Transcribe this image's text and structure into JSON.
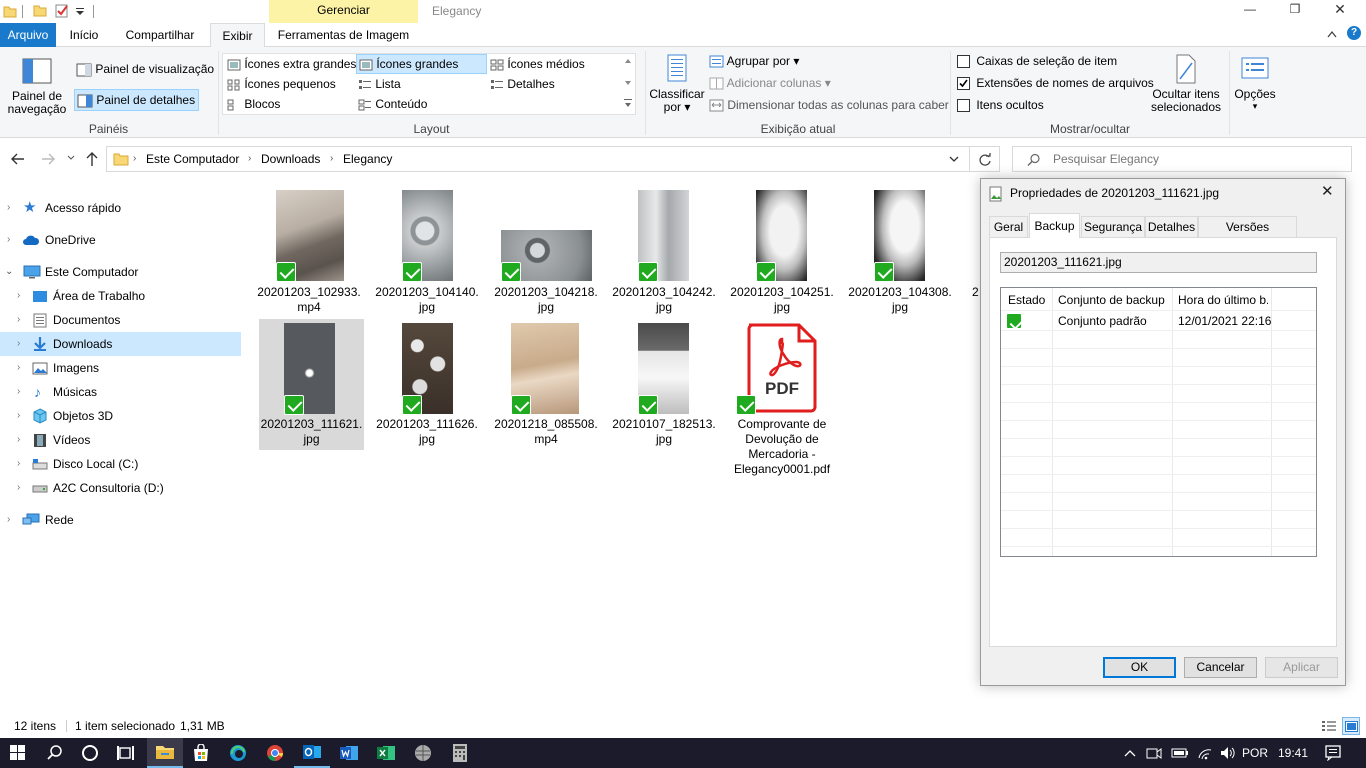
{
  "window": {
    "title": "Elegancy",
    "context_header": "Gerenciar",
    "controls": {
      "minimize": "—",
      "restore": "❐",
      "close": "✕"
    }
  },
  "tabs": {
    "arquivo": "Arquivo",
    "inicio": "Início",
    "compartilhar": "Compartilhar",
    "exibir": "Exibir",
    "ferramentas": "Ferramentas de Imagem"
  },
  "ribbon": {
    "paineis": {
      "painel_navegacao_1": "Painel de",
      "painel_navegacao_2": "navegação",
      "painel_visualizacao": "Painel de visualização",
      "painel_detalhes": "Painel de detalhes",
      "label": "Painéis"
    },
    "layout": {
      "icones_extra_grandes": "Ícones extra grandes",
      "icones_grandes": "Ícones grandes",
      "icones_medios": "Ícones médios",
      "icones_pequenos": "Ícones pequenos",
      "lista": "Lista",
      "detalhes": "Detalhes",
      "blocos": "Blocos",
      "conteudo": "Conteúdo",
      "label": "Layout"
    },
    "exibicao": {
      "classificar_1": "Classificar",
      "classificar_2": "por",
      "agrupar": "Agrupar por",
      "adicionar_colunas": "Adicionar colunas",
      "dimensionar": "Dimensionar todas as colunas para caber",
      "label": "Exibição atual"
    },
    "mostrar": {
      "caixas": "Caixas de seleção de item",
      "extensoes": "Extensões de nomes de arquivos",
      "ocultos": "Itens ocultos",
      "ocultar_1": "Ocultar itens",
      "ocultar_2": "selecionados",
      "label": "Mostrar/ocultar"
    },
    "opcoes": "Opções"
  },
  "address": {
    "crumbs": [
      "Este Computador",
      "Downloads",
      "Elegancy"
    ],
    "search_placeholder": "Pesquisar Elegancy"
  },
  "nav": {
    "acesso_rapido": "Acesso rápido",
    "onedrive": "OneDrive",
    "este_computador": "Este Computador",
    "area_trabalho": "Área de Trabalho",
    "documentos": "Documentos",
    "downloads": "Downloads",
    "imagens": "Imagens",
    "musicas": "Músicas",
    "objetos3d": "Objetos 3D",
    "videos": "Vídeos",
    "disco_c": "Disco Local (C:)",
    "disco_d": "A2C Consultoria (D:)",
    "rede": "Rede"
  },
  "files": [
    {
      "l1": "20201203_102933.",
      "l2": "mp4"
    },
    {
      "l1": "20201203_104140.",
      "l2": "jpg"
    },
    {
      "l1": "20201203_104218.",
      "l2": "jpg"
    },
    {
      "l1": "20201203_104242.",
      "l2": "jpg"
    },
    {
      "l1": "20201203_104251.",
      "l2": "jpg"
    },
    {
      "l1": "20201203_104308.",
      "l2": "jpg"
    },
    {
      "l1": "2",
      "l2": ""
    },
    {
      "l1": "20201203_111621.",
      "l2": "jpg"
    },
    {
      "l1": "20201203_111626.",
      "l2": "jpg"
    },
    {
      "l1": "20201218_085508.",
      "l2": "mp4"
    },
    {
      "l1": "20210107_182513.",
      "l2": "jpg"
    },
    {
      "l1": "Comprovante de",
      "l2": "Devolução de",
      "l3": "Mercadoria -",
      "l4": "Elegancy0001.pdf"
    }
  ],
  "pdf_label": "PDF",
  "dialog": {
    "title": "Propriedades de 20201203_111621.jpg",
    "tabs": [
      "Geral",
      "Backup",
      "Segurança",
      "Detalhes",
      "Versões Anteriores"
    ],
    "filename": "20201203_111621.jpg",
    "columns": [
      "Estado",
      "Conjunto de backup",
      "Hora do último b..."
    ],
    "row": {
      "set": "Conjunto padrão",
      "time": "12/01/2021 22:16"
    },
    "buttons": {
      "ok": "OK",
      "cancel": "Cancelar",
      "apply": "Aplicar"
    }
  },
  "status": {
    "count": "12 itens",
    "selection": "1 item selecionado",
    "size": "1,31 MB"
  },
  "taskbar": {
    "language": "POR",
    "time": "19:41"
  }
}
